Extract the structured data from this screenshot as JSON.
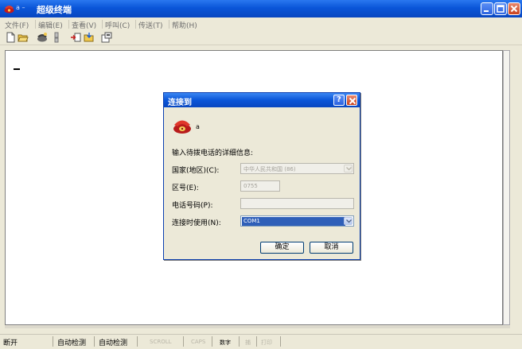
{
  "window": {
    "title": "超级终端",
    "icon_subtitle": "a –",
    "controls": {
      "minimize_icon": "minimize-icon",
      "maximize_icon": "maximize-icon",
      "close_icon": "close-icon"
    }
  },
  "menu": {
    "items": [
      {
        "label": "文件(F)"
      },
      {
        "label": "编辑(E)"
      },
      {
        "label": "查看(V)"
      },
      {
        "label": "呼叫(C)"
      },
      {
        "label": "传送(T)"
      },
      {
        "label": "帮助(H)"
      }
    ]
  },
  "toolbar": {
    "icons": [
      "new-file-icon",
      "open-folder-icon",
      "connect-phone-icon",
      "disconnect-icon",
      "send-file-icon",
      "receive-file-icon",
      "properties-icon"
    ]
  },
  "dialog": {
    "title": "连接到",
    "help_label": "?",
    "subtitle": "a",
    "prompt": "输入待拨电话的详细信息:",
    "country": {
      "label": "国家(地区)(C):",
      "value": "中华人民共和国 (86)"
    },
    "area_code": {
      "label": "区号(E):",
      "value": "0755"
    },
    "phone": {
      "label": "电话号码(P):",
      "value": ""
    },
    "connect_using": {
      "label": "连接时使用(N):",
      "value": "COM1"
    },
    "ok_label": "确定",
    "cancel_label": "取消"
  },
  "status": {
    "state": "断开",
    "detect1": "自动检测",
    "detect2": "自动检测",
    "scroll": "SCROLL",
    "caps": "CAPS",
    "num": "数字",
    "capture": "捕",
    "print": "打印"
  },
  "colors": {
    "title_bar": "#0a55d8",
    "dialog_frame": "#0a3fb0",
    "selection": "#2f5fb8",
    "close_button": "#c9421e",
    "window_face": "#ece9d8"
  }
}
